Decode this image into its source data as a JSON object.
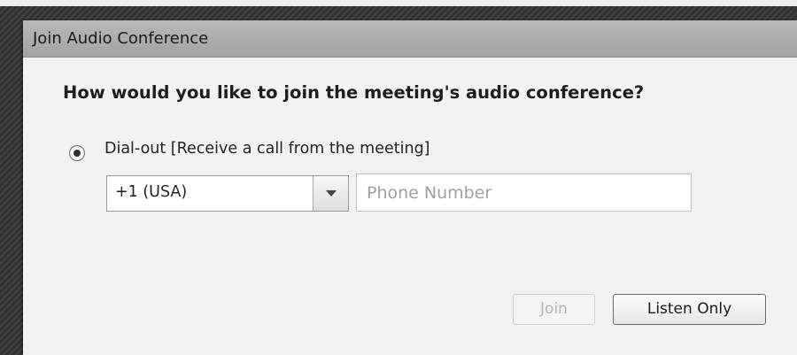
{
  "dialog": {
    "title": "Join Audio Conference",
    "question": "How would you like to join the meeting's audio conference?",
    "options": [
      {
        "label": "Dial-out [Receive a call from the meeting]",
        "selected": true
      }
    ],
    "country_code": {
      "selected": "+1 (USA)"
    },
    "phone_number": {
      "placeholder": "Phone Number",
      "value": ""
    },
    "buttons": {
      "join": {
        "label": "Join",
        "enabled": false
      },
      "listen_only": {
        "label": "Listen Only",
        "enabled": true
      }
    }
  },
  "icons": {
    "dropdown": "chevron-down-icon",
    "radio": "radio-selected-icon"
  }
}
